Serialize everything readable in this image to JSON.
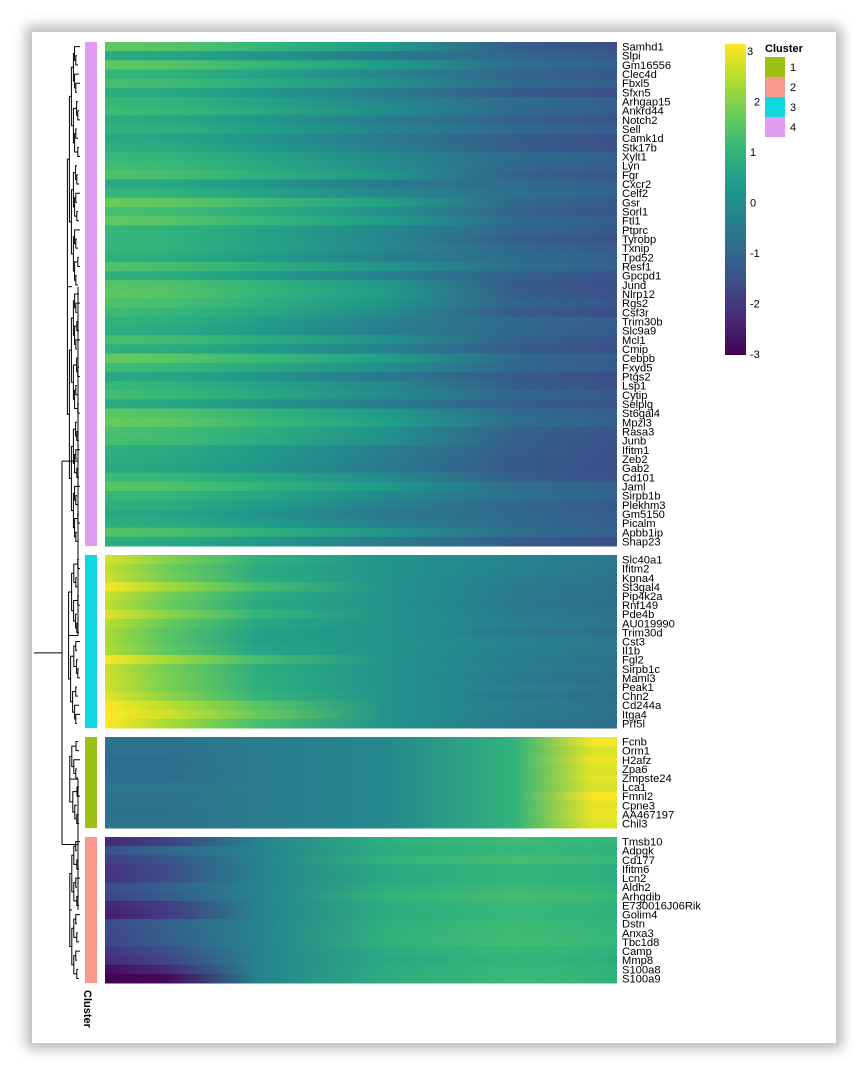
{
  "chart_data": {
    "type": "heatmap",
    "colorscale": {
      "name": "viridis",
      "range": [
        -3,
        3
      ],
      "ticks": [
        "3",
        "2",
        "1",
        "0",
        "-1",
        "-2",
        "-3"
      ]
    },
    "cluster_annotation_label": "Cluster",
    "legend": {
      "title": "Cluster",
      "items": [
        {
          "label": "1",
          "color": "#9BC013"
        },
        {
          "label": "2",
          "color": "#F8978B"
        },
        {
          "label": "3",
          "color": "#11D8E0"
        },
        {
          "label": "4",
          "color": "#E19BF0"
        }
      ]
    },
    "blocks": [
      {
        "cluster": "4",
        "color": "#E19BF0",
        "pattern": "high-left",
        "genes": [
          "Samhd1",
          "Slpi",
          "Gm16556",
          "Clec4d",
          "Fbxl5",
          "Sfxn5",
          "Arhgap15",
          "Ankrd44",
          "Notch2",
          "Sell",
          "Camk1d",
          "Stk17b",
          "Xylt1",
          "Lyn",
          "Fgr",
          "Cxcr2",
          "Celf2",
          "Gsr",
          "Sorl1",
          "Ftl1",
          "Ptprc",
          "Tyrobp",
          "Txnip",
          "Tpd52",
          "Resf1",
          "Gpcpd1",
          "Jund",
          "Nlrp12",
          "Rgs2",
          "Csf3r",
          "Trim30b",
          "Slc9a9",
          "Mcl1",
          "Cmip",
          "Cebpb",
          "Fxyd5",
          "Ptgs2",
          "Lsp1",
          "Cytip",
          "Selplg",
          "St6gal4",
          "Mpzl3",
          "Rasa3",
          "Junb",
          "Ifitm1",
          "Zeb2",
          "Gab2",
          "Cd101",
          "Jaml",
          "Sirpb1b",
          "Plekhm3",
          "Gm5150",
          "Picalm",
          "Apbb1ip",
          "Shap23"
        ]
      },
      {
        "cluster": "3",
        "color": "#11D8E0",
        "pattern": "peak-left",
        "genes": [
          "Slc40a1",
          "Ifitm2",
          "Kpna4",
          "St3gal4",
          "Pip4k2a",
          "Rnf149",
          "Pde4b",
          "AU019990",
          "Trim30d",
          "Cst3",
          "Il1b",
          "Fgl2",
          "Sirpb1c",
          "Maml3",
          "Peak1",
          "Chn2",
          "Cd244a",
          "Itga4",
          "Prf5l"
        ]
      },
      {
        "cluster": "1",
        "color": "#9BC013",
        "pattern": "peak-right",
        "genes": [
          "Fcnb",
          "Orm1",
          "H2afz",
          "Zpa6",
          "Zmpste24",
          "Lca1",
          "Fmnl2",
          "Cpne3",
          "AA467197",
          "Chil3"
        ]
      },
      {
        "cluster": "2",
        "color": "#F8978B",
        "pattern": "low-left",
        "genes": [
          "Tmsb10",
          "Adpgk",
          "Cd177",
          "Ifitm6",
          "Lcn2",
          "Aldh2",
          "Arhgdib",
          "E730016J06Rik",
          "Golim4",
          "Dstn",
          "Anxa3",
          "Tbc1d8",
          "Camp",
          "Mmp8",
          "S100a8",
          "S100a9"
        ]
      }
    ]
  }
}
